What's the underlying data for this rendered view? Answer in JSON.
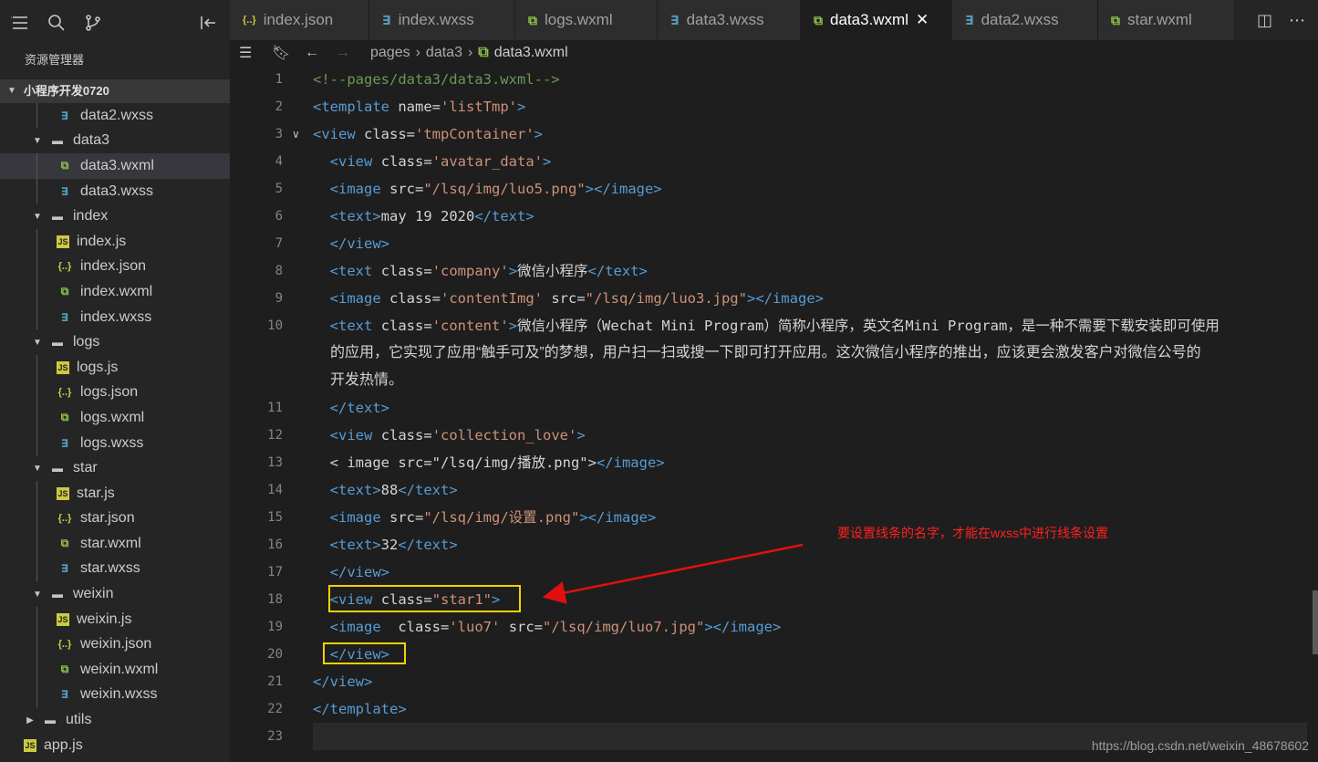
{
  "left_toolbar": {
    "icons": [
      "menu-icon",
      "search-icon",
      "source-control-icon",
      "collapse-sidebar-icon"
    ]
  },
  "explorer": {
    "title": "资源管理器",
    "project": "小程序开发0720",
    "items": [
      {
        "label": "data2.wxss",
        "type": "wxss",
        "depth": 2
      },
      {
        "label": "data3",
        "type": "folder",
        "depth": 1
      },
      {
        "label": "data3.wxml",
        "type": "wxml",
        "depth": 2,
        "selected": true
      },
      {
        "label": "data3.wxss",
        "type": "wxss",
        "depth": 2
      },
      {
        "label": "index",
        "type": "folder",
        "depth": 1
      },
      {
        "label": "index.js",
        "type": "js",
        "depth": 2
      },
      {
        "label": "index.json",
        "type": "json",
        "depth": 2
      },
      {
        "label": "index.wxml",
        "type": "wxml",
        "depth": 2
      },
      {
        "label": "index.wxss",
        "type": "wxss",
        "depth": 2
      },
      {
        "label": "logs",
        "type": "folder",
        "depth": 1
      },
      {
        "label": "logs.js",
        "type": "js",
        "depth": 2
      },
      {
        "label": "logs.json",
        "type": "json",
        "depth": 2
      },
      {
        "label": "logs.wxml",
        "type": "wxml",
        "depth": 2
      },
      {
        "label": "logs.wxss",
        "type": "wxss",
        "depth": 2
      },
      {
        "label": "star",
        "type": "folder",
        "depth": 1
      },
      {
        "label": "star.js",
        "type": "js",
        "depth": 2
      },
      {
        "label": "star.json",
        "type": "json",
        "depth": 2
      },
      {
        "label": "star.wxml",
        "type": "wxml",
        "depth": 2
      },
      {
        "label": "star.wxss",
        "type": "wxss",
        "depth": 2
      },
      {
        "label": "weixin",
        "type": "folder",
        "depth": 1
      },
      {
        "label": "weixin.js",
        "type": "js",
        "depth": 2
      },
      {
        "label": "weixin.json",
        "type": "json",
        "depth": 2
      },
      {
        "label": "weixin.wxml",
        "type": "wxml",
        "depth": 2
      },
      {
        "label": "weixin.wxss",
        "type": "wxss",
        "depth": 2
      },
      {
        "label": "utils",
        "type": "folder-closed",
        "depth": 0
      },
      {
        "label": "app.js",
        "type": "js",
        "depth": 0
      }
    ]
  },
  "tabs": [
    {
      "label": "index.json",
      "type": "json"
    },
    {
      "label": "index.wxss",
      "type": "wxss"
    },
    {
      "label": "logs.wxml",
      "type": "wxml"
    },
    {
      "label": "data3.wxss",
      "type": "wxss"
    },
    {
      "label": "data3.wxml",
      "type": "wxml",
      "active": true
    },
    {
      "label": "data2.wxss",
      "type": "wxss"
    },
    {
      "label": "star.wxml",
      "type": "wxml"
    }
  ],
  "breadcrumb": {
    "parts": [
      "pages",
      "data3",
      "data3.wxml"
    ]
  },
  "editor": {
    "lines": [
      {
        "n": "1",
        "html": "<span class='c'>&lt;!--pages/data3/data3.wxml--&gt;</span>"
      },
      {
        "n": "2",
        "html": "<span class='t'>&lt;template</span> <span class='a'>name=</span><span class='s'>'listTmp'</span><span class='t'>&gt;</span>"
      },
      {
        "n": "3",
        "html": "<span class='t'>&lt;view</span> <span class='a'>class=</span><span class='s'>'tmpContainer'</span><span class='t'>&gt;</span>",
        "fold": true
      },
      {
        "n": "4",
        "html": "  <span class='t'>&lt;view</span> <span class='a'>class=</span><span class='s'>'avatar_data'</span><span class='t'>&gt;</span>"
      },
      {
        "n": "5",
        "html": "  <span class='t'>&lt;image</span> <span class='a'>src=</span><span class='s'>\"/lsq/img/luo5.png\"</span><span class='t'>&gt;&lt;/image&gt;</span>"
      },
      {
        "n": "6",
        "html": "  <span class='t'>&lt;text&gt;</span>may 19 2020<span class='t'>&lt;/text&gt;</span>"
      },
      {
        "n": "7",
        "html": "  <span class='t'>&lt;/view&gt;</span>"
      },
      {
        "n": "8",
        "html": "  <span class='t'>&lt;text</span> <span class='a'>class=</span><span class='s'>'company'</span><span class='t'>&gt;</span>微信小程序<span class='t'>&lt;/text&gt;</span>"
      },
      {
        "n": "9",
        "html": "  <span class='t'>&lt;image</span> <span class='a'>class=</span><span class='s'>'contentImg'</span> <span class='a'>src=</span><span class='s'>\"/lsq/img/luo3.jpg\"</span><span class='t'>&gt;&lt;/image&gt;</span>"
      },
      {
        "n": "10",
        "html": "  <span class='t'>&lt;text</span> <span class='a'>class=</span><span class='s'>'content'</span><span class='t'>&gt;</span>微信小程序（Wechat Mini Program）简称小程序，英文名Mini Program，是一种不需要下载安装即可使用"
      },
      {
        "n": "",
        "wrap": "的应用，它实现了应用“触手可及”的梦想，用户扫一扫或搜一下即可打开应用。这次微信小程序的推出，应该更会激发客户对微信公号的"
      },
      {
        "n": "",
        "wrap": "开发热情。"
      },
      {
        "n": "11",
        "html": "  <span class='t'>&lt;/text&gt;</span>"
      },
      {
        "n": "12",
        "html": "  <span class='t'>&lt;view</span> <span class='a'>class=</span><span class='s'>'collection_love'</span><span class='t'>&gt;</span>"
      },
      {
        "n": "13",
        "html": "  &lt; image src=\"/lsq/img/播放.png\"&gt;<span class='t'>&lt;/image&gt;</span>"
      },
      {
        "n": "14",
        "html": "  <span class='t'>&lt;text&gt;</span>88<span class='t'>&lt;/text&gt;</span>"
      },
      {
        "n": "15",
        "html": "  <span class='t'>&lt;image</span> <span class='a'>src=</span><span class='s'>\"/lsq/img/设置.png\"</span><span class='t'>&gt;&lt;/image&gt;</span>"
      },
      {
        "n": "16",
        "html": "  <span class='t'>&lt;text&gt;</span>32<span class='t'>&lt;/text&gt;</span>"
      },
      {
        "n": "17",
        "html": "  <span class='t'>&lt;/view&gt;</span>"
      },
      {
        "n": "18",
        "html": "  <span class='t'>&lt;view</span> <span class='a'>class=</span><span class='s'>\"star1\"</span><span class='t'>&gt;</span>"
      },
      {
        "n": "19",
        "html": "  <span class='t'>&lt;image</span>  <span class='a'>class=</span><span class='s'>'luo7'</span> <span class='a'>src=</span><span class='s'>\"/lsq/img/luo7.jpg\"</span><span class='t'>&gt;&lt;/image&gt;</span>"
      },
      {
        "n": "20",
        "html": "  <span class='t'>&lt;/view&gt;</span>"
      },
      {
        "n": "21",
        "html": "<span class='t'>&lt;/view&gt;</span>"
      },
      {
        "n": "22",
        "html": "<span class='t'>&lt;/template&gt;</span>"
      },
      {
        "n": "23",
        "html": ""
      }
    ]
  },
  "annotation": {
    "text": "要设置线条的名字，才能在wxss中进行线条设置",
    "color": "#ff2020",
    "box_color": "#f2d100"
  },
  "watermark": "https://blog.csdn.net/weixin_48678602",
  "colors": {
    "tag": "#569cd6",
    "string": "#ce9178",
    "comment": "#6a9955",
    "editor_bg": "#1e1e1e",
    "sidebar_bg": "#252526"
  }
}
